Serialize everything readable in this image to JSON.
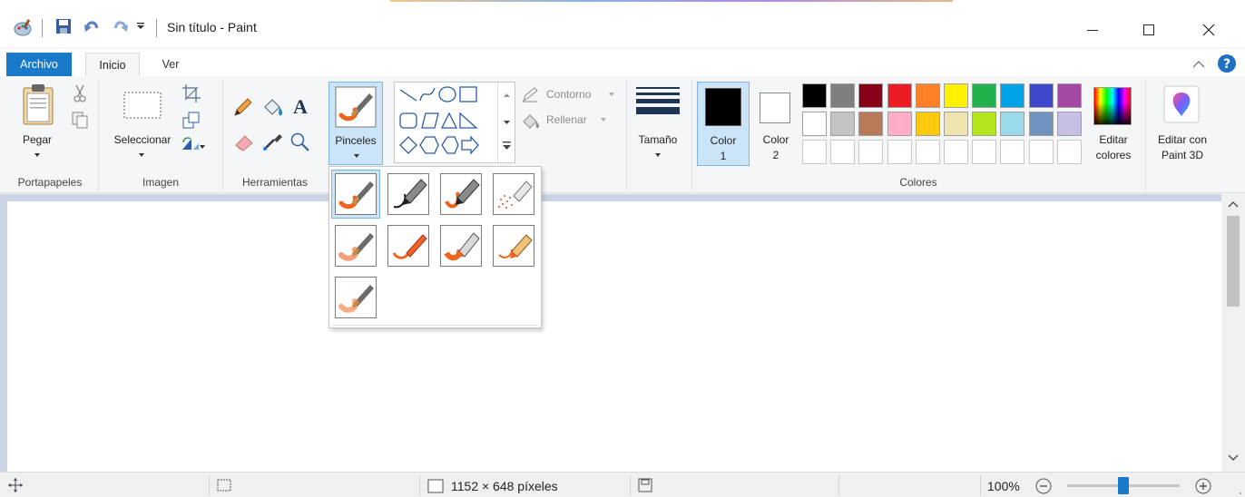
{
  "titlebar": {
    "title": "Sin título - Paint"
  },
  "tabs": {
    "archivo": "Archivo",
    "inicio": "Inicio",
    "ver": "Ver"
  },
  "ribbon": {
    "portapapeles": {
      "pegar": "Pegar",
      "label": "Portapapeles"
    },
    "imagen": {
      "seleccionar": "Seleccionar",
      "label": "Imagen"
    },
    "herramientas": {
      "label": "Herramientas"
    },
    "pinceles": {
      "label": "Pinceles"
    },
    "formas": {
      "contorno": "Contorno",
      "rellenar": "Rellenar"
    },
    "tamano": {
      "label": "Tamaño"
    },
    "color1": {
      "line1": "Color",
      "line2": "1",
      "value": "#000000"
    },
    "color2": {
      "line1": "Color",
      "line2": "2",
      "value": "#ffffff"
    },
    "colores": {
      "label": "Colores",
      "row1": [
        "#000000",
        "#7f7f7f",
        "#880015",
        "#ed1c24",
        "#ff7f27",
        "#fff200",
        "#22b14c",
        "#00a2e8",
        "#3f48cc",
        "#a349a4"
      ],
      "row2": [
        "#ffffff",
        "#c3c3c3",
        "#b97a57",
        "#ffaec9",
        "#ffc90e",
        "#efe4b0",
        "#b5e61d",
        "#99d9ea",
        "#7092be",
        "#c8bfe7"
      ]
    },
    "editar_colores": {
      "line1": "Editar",
      "line2": "colores"
    },
    "paint3d": {
      "line1": "Editar con",
      "line2": "Paint 3D"
    }
  },
  "status": {
    "dimensions": "1152 × 648 píxeles",
    "zoom": "100%",
    "zoom_level": 0.5
  },
  "accent": "#1979ca"
}
